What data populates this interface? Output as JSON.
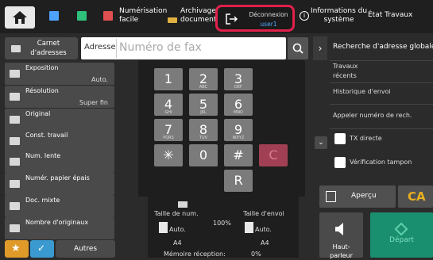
{
  "topbar": {
    "scan_easy": "Numérisation\nfacile",
    "archive": "Archivage de\ndocument",
    "logout_label": "Déconnexion",
    "logout_user": "user1",
    "sysinfo": "Informations du\nsystème",
    "state": "État Travaux"
  },
  "addressbar": {
    "carnet": "Carnet\nd'adresses",
    "label": "Adresse",
    "placeholder": "Numéro de fax"
  },
  "right_panel": {
    "search_global": "Recherche d'adresse globale",
    "recent": "Travaux\nrécents",
    "history": "Historique d'envoi",
    "recall": "Appeler numéro de rech.",
    "tx_direct": "TX directe",
    "stamp": "Vérification tampon"
  },
  "sidebar": [
    {
      "label": "Exposition",
      "value": "Auto."
    },
    {
      "label": "Résolution",
      "value": "Super fin"
    },
    {
      "label": "Original",
      "value": ""
    },
    {
      "label": "Const. travail",
      "value": ""
    },
    {
      "label": "Num. lente",
      "value": ""
    },
    {
      "label": "Numér. papier épais",
      "value": ""
    },
    {
      "label": "Doc. mixte",
      "value": ""
    },
    {
      "label": "Nombre d'originaux",
      "value": ""
    }
  ],
  "others": "Autres",
  "keypad": {
    "keys": [
      {
        "n": "1",
        "s": ""
      },
      {
        "n": "2",
        "s": "ABC"
      },
      {
        "n": "3",
        "s": "DEF"
      },
      {
        "n": "4",
        "s": "GHI"
      },
      {
        "n": "5",
        "s": "JKL"
      },
      {
        "n": "6",
        "s": "MNO"
      },
      {
        "n": "7",
        "s": "PQRS"
      },
      {
        "n": "8",
        "s": "TUV"
      },
      {
        "n": "9",
        "s": "WXYZ"
      },
      {
        "n": "✳",
        "s": ""
      },
      {
        "n": "0",
        "s": ""
      },
      {
        "n": "#",
        "s": ""
      }
    ],
    "clear": "C",
    "r": "R"
  },
  "info": {
    "scan_size_label": "Taille de num.",
    "send_size_label": "Taille d'envoi",
    "ratio": "100%",
    "scan_size": "Auto.",
    "send_size": "Auto.",
    "paper_left": "A4",
    "paper_right": "A4",
    "memory_label": "Mémoire réception:",
    "memory_value": "0%"
  },
  "actions": {
    "preview": "Aperçu",
    "ca": "CA",
    "speaker": "Haut-\nparleur",
    "start": "Départ"
  }
}
